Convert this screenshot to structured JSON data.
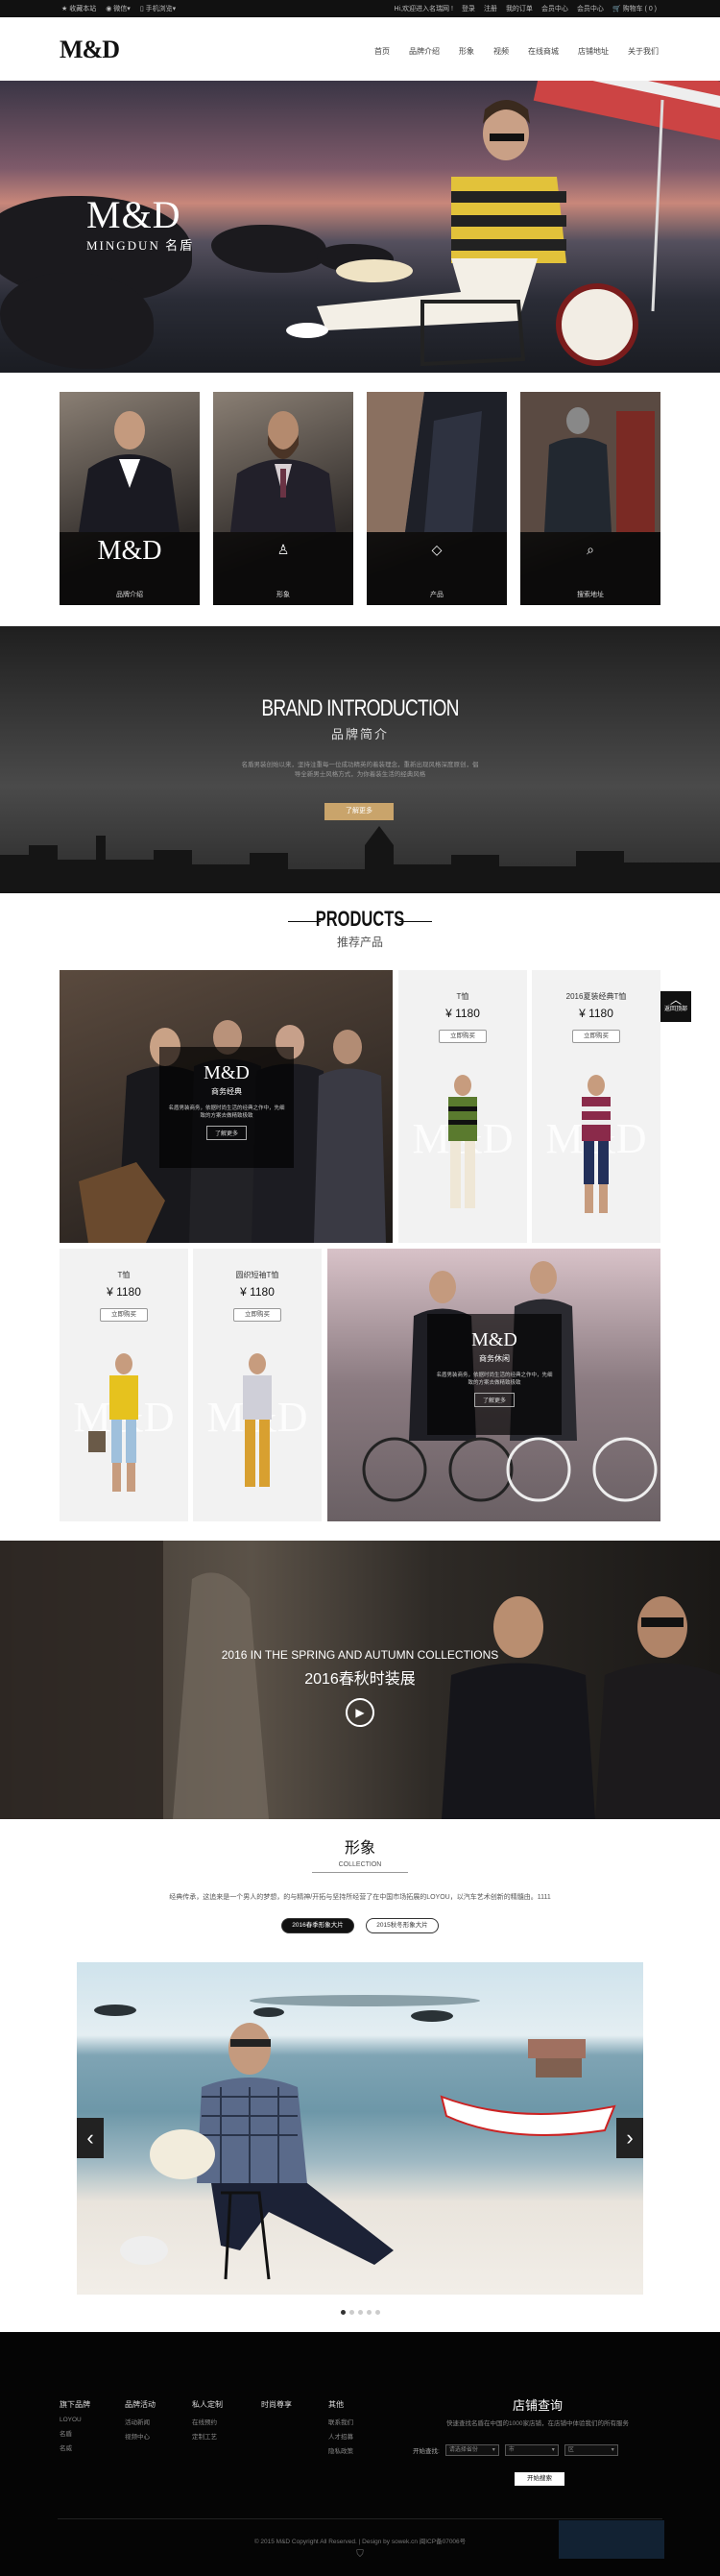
{
  "topbar": {
    "left": [
      "收藏本站",
      "微信",
      "手机浏览"
    ],
    "right": [
      "Hi,欢迎进入名瑞网 !",
      "登录",
      "注册",
      "我的订单",
      "会员中心",
      "会员中心",
      "购物车 ( 0 )"
    ]
  },
  "header": {
    "logo": "M&D",
    "nav": [
      "首页",
      "品牌介绍",
      "形象",
      "视频",
      "在线商城",
      "店铺地址",
      "关于我们"
    ]
  },
  "hero": {
    "brand": "M&D",
    "brand_sub": "MINGDUN 名盾"
  },
  "cards": [
    {
      "label": "品牌介绍",
      "logo": "M&D"
    },
    {
      "label": "形象",
      "icon": "hanger-icon"
    },
    {
      "label": "产品",
      "icon": "diamond-icon"
    },
    {
      "label": "搜索地址",
      "icon": "search-icon"
    }
  ],
  "intro": {
    "title": "BRAND INTRODUCTION",
    "subtitle": "品牌简介",
    "text": "名盾男装创始以来，坚持注重每一位成功精英的着装理念，重新出现风格深度原创，倡导全新男士风格方式，为你着装生活的经典风格",
    "button": "了解更多"
  },
  "products": {
    "title": "PRODUCTS",
    "subtitle": "推荐产品",
    "big1": {
      "logo": "M&D",
      "name": "商务经典",
      "desc": "名盾男装商务，依据时尚生活的经典之作中，先细致的方案去做精致极致",
      "button": "了解更多"
    },
    "items": [
      {
        "name": "T恤",
        "price": "¥ 1180",
        "button": "立即购买"
      },
      {
        "name": "2016夏装经典T恤",
        "price": "¥ 1180",
        "button": "立即购买"
      },
      {
        "name": "T恤",
        "price": "¥ 1180",
        "button": "立即购买"
      },
      {
        "name": "圆织短袖T恤",
        "price": "¥ 1180",
        "button": "立即购买"
      }
    ],
    "big2": {
      "logo": "M&D",
      "name": "商务休闲",
      "desc": "名盾男装商务，依据时尚生活的经典之作中，先细致的方案去做精致极致",
      "button": "了解更多"
    },
    "watermark": "M&D",
    "back_top": "返回顶部"
  },
  "autumn": {
    "title_en": "2016 IN THE SPRING AND AUTUMN COLLECTIONS",
    "title_cn": "2016春秋时装展"
  },
  "image": {
    "title": "形象",
    "subtitle": "COLLECTION",
    "text": "经典传承，这追来是一个男人的梦想，的与精神/开拓与坚持所经营了在中国市场拓展的LOYOU，以汽车艺术创新的精髓由。1111",
    "tabs": [
      "2016春季形象大片",
      "2015秋冬形象大片"
    ]
  },
  "footer": {
    "cols": [
      {
        "title": "旗下品牌",
        "items": [
          "LOYOU",
          "名盾",
          "名威"
        ]
      },
      {
        "title": "品牌活动",
        "items": [
          "活动新闻",
          "视频中心"
        ]
      },
      {
        "title": "私人定制",
        "items": [
          "在线预约",
          "定制工艺"
        ]
      },
      {
        "title": "时尚尊享",
        "items": []
      },
      {
        "title": "其他",
        "items": [
          "联系我们",
          "人才招募",
          "隐私政策"
        ]
      }
    ],
    "store_title": "店铺查询",
    "store_desc": "快速查找名盾在中国的1000家店铺，在店铺中体验我们的所有服务",
    "select_label": "开始查找:",
    "selects": [
      "请选择省份",
      "市",
      "区"
    ],
    "search": "开始搜索",
    "copyright": "© 2015 M&D Copyright All Reserved. | Design by sowek.cn   闽ICP备07006号"
  },
  "colors": {
    "accent": "#c9a46b",
    "dark": "#111111"
  }
}
